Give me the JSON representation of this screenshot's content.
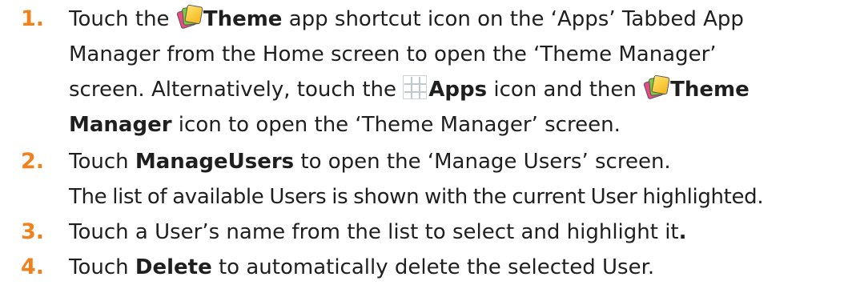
{
  "steps": [
    {
      "number": "1.",
      "parts": {
        "a": "Touch the ",
        "theme_bold": "Theme",
        "b": " app shortcut icon on the ‘Apps’ Tabbed App",
        "c": "Manager from the Home screen to open the ‘Theme Manager’",
        "d": "screen. Alternatively, touch the ",
        "apps_bold": "Apps",
        "e": " icon and then ",
        "theme2_bold": "Theme",
        "f_bold": "Manager",
        "g": " icon to open the ‘Theme Manager’ screen."
      }
    },
    {
      "number": "2.",
      "parts": {
        "a": "Touch ",
        "bold": "ManageUsers",
        "b": " to open the ‘Manage Users’ screen.",
        "c": "The list of available Users is shown with the current User highlighted."
      }
    },
    {
      "number": "3.",
      "parts": {
        "a": "Touch a User’s name from the list to select and highlight it",
        "bold_period": "."
      }
    },
    {
      "number": "4.",
      "parts": {
        "a": "Touch ",
        "bold": "Delete",
        "b": " to automatically delete the selected User."
      }
    }
  ],
  "icons": {
    "theme": "theme-icon",
    "apps": "apps-grid-icon"
  },
  "colors": {
    "step_number": "#f0821e",
    "text": "#1f1f1f"
  }
}
